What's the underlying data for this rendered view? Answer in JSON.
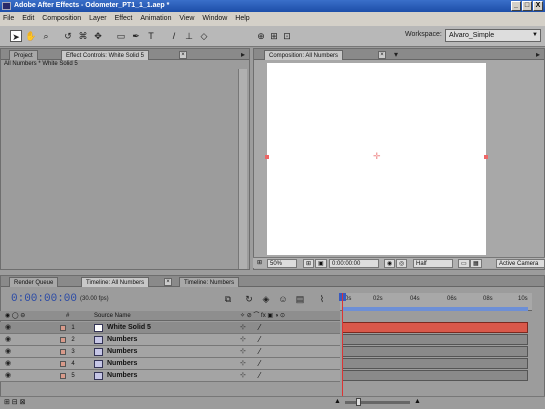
{
  "window": {
    "title": "Adobe After Effects - Odometer_PT1_1_1.aep *",
    "min_glyph": "_",
    "max_glyph": "□",
    "close_glyph": "X"
  },
  "menu": [
    "File",
    "Edit",
    "Composition",
    "Layer",
    "Effect",
    "Animation",
    "View",
    "Window",
    "Help"
  ],
  "toolbar": {
    "workspace_label": "Workspace:",
    "workspace_value": "Alvaro_Simple"
  },
  "project_panel": {
    "tab_project": "Project",
    "tab_effect_controls": "Effect Controls: White Solid 5",
    "breadcrumb": "All Numbers * White Solid 5"
  },
  "comp_panel": {
    "tab": "Composition: All Numbers",
    "zoom": "50%",
    "timecode": "0:00:00:00",
    "resolution": "Half",
    "camera": "Active Camera"
  },
  "timeline": {
    "tabs": [
      "Render Queue",
      "Timeline: All Numbers",
      "Timeline: Numbers"
    ],
    "timecode": "0:00:00:00",
    "fps": "(30.00 fps)",
    "col_hash": "#",
    "col_source": "Source Name",
    "ruler": [
      "0s",
      "02s",
      "04s",
      "06s",
      "08s",
      "10s"
    ],
    "layers": [
      {
        "num": "1",
        "name": "White Solid 5",
        "color": "#d9584a",
        "selected": true
      },
      {
        "num": "2",
        "name": "Numbers",
        "color": "#8a8a8a",
        "selected": false
      },
      {
        "num": "3",
        "name": "Numbers",
        "color": "#8a8a8a",
        "selected": false
      },
      {
        "num": "4",
        "name": "Numbers",
        "color": "#8a8a8a",
        "selected": false
      },
      {
        "num": "5",
        "name": "Numbers",
        "color": "#8a8a8a",
        "selected": false
      }
    ]
  },
  "colors": {
    "accent": "#2a4aa6",
    "selected_bar": "#d9584a",
    "bar": "#8a8a8a"
  }
}
